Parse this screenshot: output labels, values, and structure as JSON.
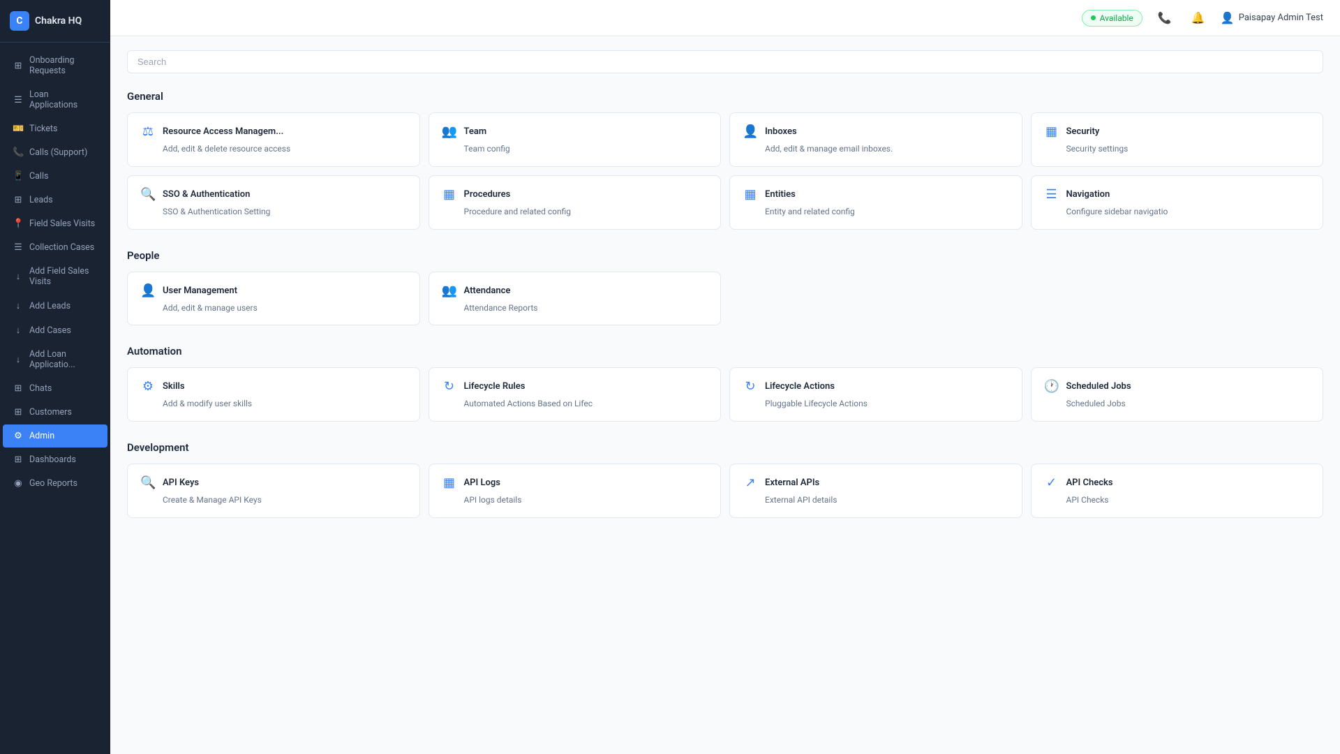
{
  "app": {
    "name": "Chakra HQ"
  },
  "header": {
    "status": "Available",
    "user": "Paisapay Admin Test"
  },
  "sidebar": {
    "items": [
      {
        "id": "onboarding-requests",
        "label": "Onboarding Requests",
        "icon": "⊞"
      },
      {
        "id": "loan-applications",
        "label": "Loan Applications",
        "icon": "☰"
      },
      {
        "id": "tickets",
        "label": "Tickets",
        "icon": "🎫"
      },
      {
        "id": "calls-support",
        "label": "Calls (Support)",
        "icon": "📞"
      },
      {
        "id": "calls",
        "label": "Calls",
        "icon": "📱"
      },
      {
        "id": "leads",
        "label": "Leads",
        "icon": "⊞"
      },
      {
        "id": "field-sales-visits",
        "label": "Field Sales Visits",
        "icon": "📍"
      },
      {
        "id": "collection-cases",
        "label": "Collection Cases",
        "icon": "☰"
      },
      {
        "id": "add-field-sales-visits",
        "label": "Add Field Sales Visits",
        "icon": "↓"
      },
      {
        "id": "add-leads",
        "label": "Add Leads",
        "icon": "↓"
      },
      {
        "id": "add-cases",
        "label": "Add Cases",
        "icon": "↓"
      },
      {
        "id": "add-loan-applications",
        "label": "Add Loan Applicatio...",
        "icon": "↓"
      },
      {
        "id": "chats",
        "label": "Chats",
        "icon": "⊞"
      },
      {
        "id": "customers",
        "label": "Customers",
        "icon": "⊞"
      },
      {
        "id": "admin",
        "label": "Admin",
        "icon": "⚙",
        "active": true
      },
      {
        "id": "dashboards",
        "label": "Dashboards",
        "icon": "⊞"
      },
      {
        "id": "geo-reports",
        "label": "Geo Reports",
        "icon": "◉"
      }
    ]
  },
  "search": {
    "placeholder": "Search"
  },
  "sections": [
    {
      "id": "general",
      "title": "General",
      "cards": [
        {
          "id": "resource-access",
          "icon": "⚖",
          "title": "Resource Access Managem...",
          "desc": "Add, edit & delete resource access"
        },
        {
          "id": "team",
          "icon": "👥",
          "title": "Team",
          "desc": "Team config"
        },
        {
          "id": "inboxes",
          "icon": "👤",
          "title": "Inboxes",
          "desc": "Add, edit & manage email inboxes."
        },
        {
          "id": "security",
          "icon": "▦",
          "title": "Security",
          "desc": "Security settings"
        },
        {
          "id": "sso-auth",
          "icon": "🔍",
          "title": "SSO & Authentication",
          "desc": "SSO & Authentication Setting"
        },
        {
          "id": "procedures",
          "icon": "▦",
          "title": "Procedures",
          "desc": "Procedure and related config"
        },
        {
          "id": "entities",
          "icon": "▦",
          "title": "Entities",
          "desc": "Entity and related config"
        },
        {
          "id": "navigation",
          "icon": "☰",
          "title": "Navigation",
          "desc": "Configure sidebar navigatio"
        }
      ]
    },
    {
      "id": "people",
      "title": "People",
      "cards": [
        {
          "id": "user-management",
          "icon": "👤",
          "title": "User Management",
          "desc": "Add, edit & manage users"
        },
        {
          "id": "attendance",
          "icon": "👥",
          "title": "Attendance",
          "desc": "Attendance Reports"
        }
      ]
    },
    {
      "id": "automation",
      "title": "Automation",
      "cards": [
        {
          "id": "skills",
          "icon": "⚙",
          "title": "Skills",
          "desc": "Add & modify user skills"
        },
        {
          "id": "lifecycle-rules",
          "icon": "↻",
          "title": "Lifecycle Rules",
          "desc": "Automated Actions Based on Lifec"
        },
        {
          "id": "lifecycle-actions",
          "icon": "↻",
          "title": "Lifecycle Actions",
          "desc": "Pluggable Lifecycle Actions"
        },
        {
          "id": "scheduled-jobs",
          "icon": "🕐",
          "title": "Scheduled Jobs",
          "desc": "Scheduled Jobs"
        }
      ]
    },
    {
      "id": "development",
      "title": "Development",
      "cards": [
        {
          "id": "api-keys",
          "icon": "🔍",
          "title": "API Keys",
          "desc": "Create & Manage API Keys"
        },
        {
          "id": "api-logs",
          "icon": "▦",
          "title": "API Logs",
          "desc": "API logs details"
        },
        {
          "id": "external-apis",
          "icon": "↗",
          "title": "External APIs",
          "desc": "External API details"
        },
        {
          "id": "api-checks",
          "icon": "✓",
          "title": "API Checks",
          "desc": "API Checks"
        }
      ]
    }
  ]
}
